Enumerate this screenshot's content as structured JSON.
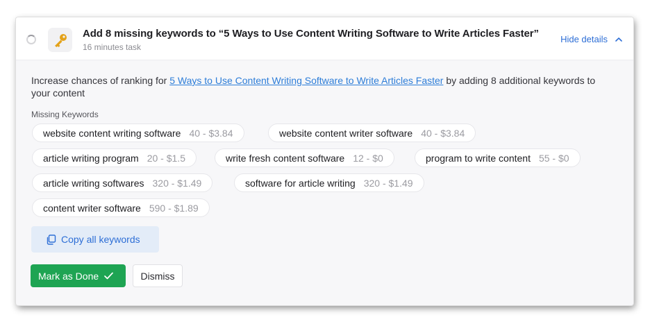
{
  "task": {
    "title": "Add 8 missing keywords to “5 Ways to Use Content Writing Software to Write Articles Faster”",
    "duration": "16 minutes task",
    "icon": "key-icon",
    "hide_details_label": "Hide details"
  },
  "description": {
    "prefix": "Increase chances of ranking for ",
    "link_text": "5 Ways to Use Content Writing Software to Write Articles Faster",
    "suffix": " by adding 8 additional keywords to your content"
  },
  "missing_keywords": {
    "label": "Missing Keywords",
    "items": [
      {
        "keyword": "website content writing software",
        "metrics": "40 - $3.84"
      },
      {
        "keyword": "website content writer software",
        "metrics": "40 - $3.84"
      },
      {
        "keyword": "article writing program",
        "metrics": "20 - $1.5"
      },
      {
        "keyword": "write fresh content software",
        "metrics": "12 - $0"
      },
      {
        "keyword": "program to write content",
        "metrics": "55 - $0"
      },
      {
        "keyword": "article writing softwares",
        "metrics": "320 - $1.49"
      },
      {
        "keyword": "software for article writing",
        "metrics": "320 - $1.49"
      },
      {
        "keyword": "content writer software",
        "metrics": "590 - $1.89"
      }
    ]
  },
  "actions": {
    "copy_label": "Copy all keywords",
    "done_label": "Mark as Done",
    "dismiss_label": "Dismiss"
  },
  "colors": {
    "accent_blue": "#2d6ed6",
    "done_green": "#1ea453",
    "key_gold": "#e3a21a"
  }
}
